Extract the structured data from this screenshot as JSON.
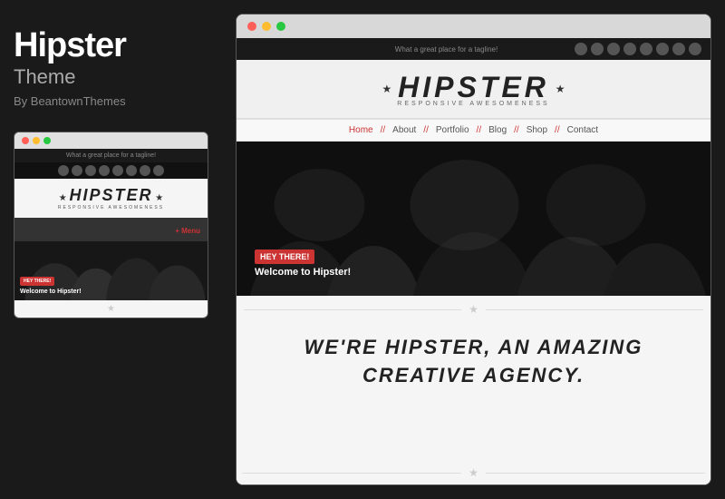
{
  "left": {
    "theme_name": "Hipster",
    "theme_subtitle": "Theme",
    "theme_author": "By BeantownThemes",
    "small_browser": {
      "dots": [
        "red",
        "yellow",
        "green"
      ],
      "tagline": "What a great place for a tagline!",
      "logo_text": "HIPSTER",
      "logo_sub": "RESPONSIVE AWESOMENESS",
      "logo_stars": "★",
      "menu_label": "+ Menu",
      "hero_tag": "HEY THERE!",
      "hero_welcome": "Welcome to Hipster!",
      "star": "★"
    }
  },
  "right": {
    "browser": {
      "dots": [
        "red",
        "yellow",
        "green"
      ],
      "topbar_tagline": "What a great place for a tagline!",
      "logo_text": "HIPSTER",
      "logo_sub": "RESPONSIVE AWESOMENESS",
      "logo_star_left": "★",
      "logo_star_right": "★",
      "nav_items": [
        "Home",
        "About",
        "Portfolio",
        "Blog",
        "Shop",
        "Contact"
      ],
      "nav_active": "Home",
      "nav_separator": "//",
      "hero_tag": "HEY THERE!",
      "hero_welcome": "Welcome to Hipster!",
      "divider_star": "★",
      "agency_line1": "WE'RE HIPSTER, AN AMAZING",
      "agency_line2": "CREATIVE AGENCY.",
      "bottom_star": "★"
    }
  }
}
